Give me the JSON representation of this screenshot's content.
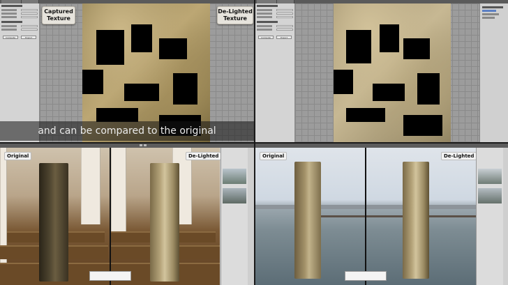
{
  "top_left": {
    "panel_rows": [
      "Capture Parameters",
      "Resolution",
      "Sample Count",
      "Ambient Occlusion",
      "Reference Parameters",
      "Position",
      "Rotation"
    ],
    "buttons": [
      "Compute",
      "Export"
    ],
    "captured_label_line1": "Captured",
    "captured_label_line2": "Texture",
    "delighted_label_line1": "De-Lighted",
    "delighted_label_line2": "Texture",
    "caption": "and can be compared to the original"
  },
  "top_right": {
    "panel_rows": [
      "Capture Parameters",
      "Resolution",
      "Sample Count",
      "Ambient Occlusion",
      "Reference Parameters",
      "Position",
      "Rotation"
    ],
    "buttons": [
      "Compute",
      "Export"
    ]
  },
  "bottom_left": {
    "original_label": "Original",
    "delighted_label": "De-Lighted"
  },
  "bottom_right": {
    "original_label": "Original",
    "delighted_label": "De-Lighted"
  },
  "colors": {
    "chip_bg": "#e6e3dc",
    "viewport_grid": "#9c9c9c",
    "panel_bg": "#d4d4d4"
  }
}
